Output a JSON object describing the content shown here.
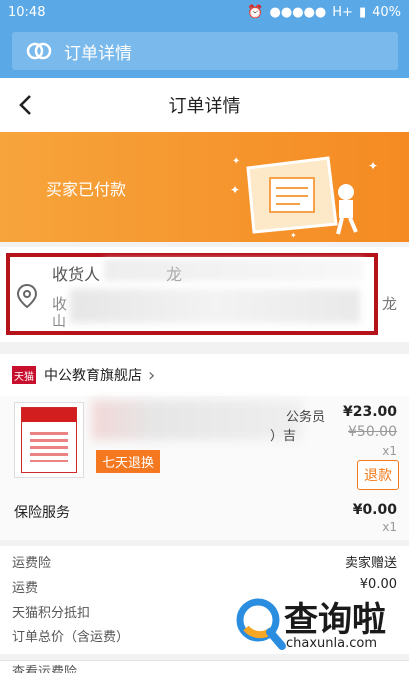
{
  "statusbar": {
    "time": "10:48",
    "carrier": "H+",
    "battery": "40%"
  },
  "appbar": {
    "title": "订单详情",
    "logo_icon": "chat-logo-icon"
  },
  "nav": {
    "title": "订单详情",
    "back_icon": "back-chevron-icon"
  },
  "banner": {
    "status": "买家已付款"
  },
  "address": {
    "recipient_label": "收货人",
    "recipient_name_partial": "龙",
    "address_prefix": "收",
    "address_prefix2": "山",
    "address_tail": "龙"
  },
  "shop": {
    "badge": "天猫",
    "name": "中公教育旗舰店"
  },
  "item": {
    "name_line1": "公务员",
    "name_line2": "）吉",
    "tag": "七天退换",
    "price": "¥23.00",
    "original_price": "¥50.00",
    "qty": "x1",
    "refund_label": "退款"
  },
  "insurance": {
    "title": "保险服务",
    "price": "¥0.00",
    "qty": "x1"
  },
  "fees": {
    "rows": [
      {
        "label": "运费险",
        "value": "卖家赠送"
      },
      {
        "label": "运费",
        "value": "¥0.00"
      },
      {
        "label": "天猫积分抵扣",
        "value": ""
      },
      {
        "label": "订单总价（含运费）",
        "value": ""
      }
    ]
  },
  "bottom": {
    "label": "查看运费险"
  },
  "watermark": {
    "text": "查询啦",
    "url": "chaxunla.com"
  }
}
